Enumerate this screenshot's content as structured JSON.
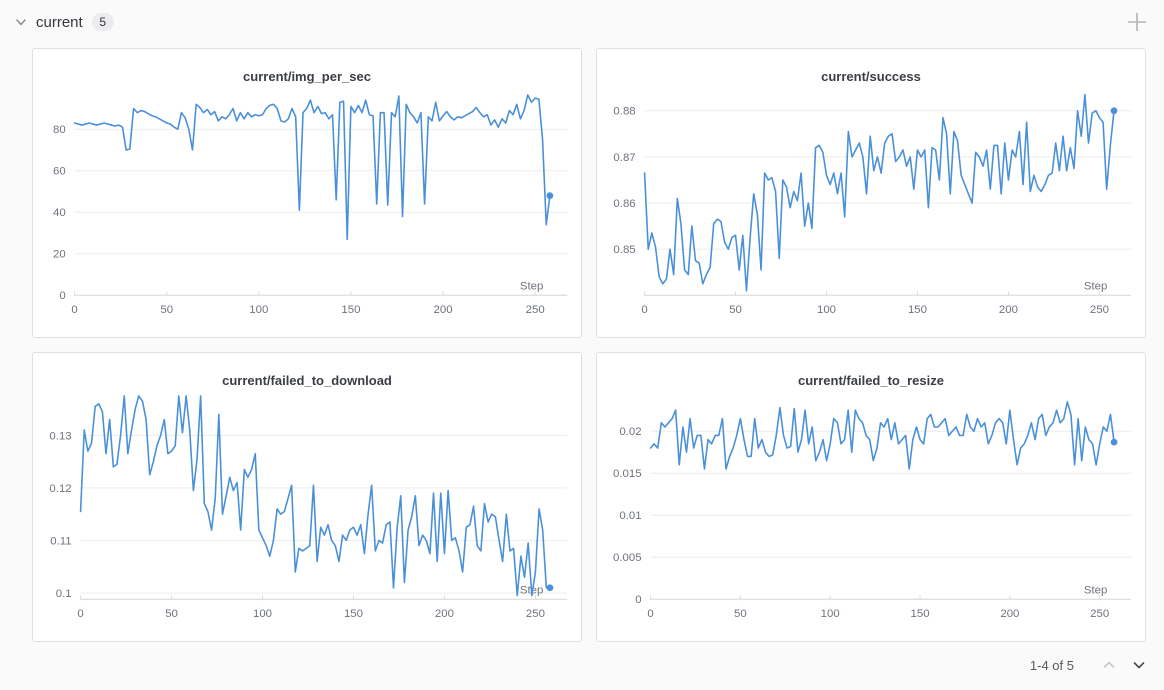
{
  "header": {
    "section_label": "current",
    "panel_count_badge": "5",
    "collapse_icon": "chevron-down-icon",
    "add_icon": "plus-icon"
  },
  "pagination": {
    "label": "1-4 of 5",
    "prev_icon": "chevron-up-icon",
    "next_icon": "chevron-down-icon",
    "prev_enabled": false,
    "next_enabled": true
  },
  "colors": {
    "series_line": "#4a90d9",
    "grid_line": "#ececec",
    "axis_line": "#d6d6d6",
    "tick_text": "#6e727c"
  },
  "chart_data": [
    {
      "type": "line",
      "title": "current/img_per_sec",
      "xlabel": "Step",
      "xticks": [
        0,
        50,
        100,
        150,
        200,
        250
      ],
      "yticks": [
        0,
        20,
        40,
        60,
        80
      ],
      "xlim": [
        0,
        262
      ],
      "ylim": [
        0,
        100
      ],
      "x_start": 0,
      "x_step": 2,
      "x_end": 258,
      "y": [
        83,
        82.5,
        82,
        82.5,
        83,
        82.5,
        82,
        82.5,
        83,
        82.5,
        82,
        81.5,
        82,
        81,
        70,
        70.5,
        90,
        88,
        89,
        88.5,
        87.5,
        86.5,
        86,
        85,
        84,
        83,
        82.5,
        81,
        80,
        88,
        85.5,
        80,
        70,
        92,
        90.5,
        88,
        89.5,
        87,
        88.5,
        84,
        86,
        85,
        87,
        90,
        84,
        88,
        85,
        88,
        86,
        87,
        86.5,
        87,
        90,
        91.5,
        92,
        90,
        84,
        83.5,
        85,
        90,
        86,
        41,
        88,
        90,
        94,
        88,
        91,
        87.5,
        88,
        85,
        87,
        46,
        93,
        93.5,
        27,
        91,
        88,
        91.5,
        88,
        94,
        87,
        86.5,
        44,
        88,
        88,
        43.5,
        88,
        86,
        96,
        38,
        92,
        88,
        86,
        83,
        88,
        44,
        86,
        84,
        93,
        84,
        86.5,
        88.5,
        86,
        84.5,
        86,
        85.5,
        86.5,
        87.5,
        88.5,
        90.5,
        88,
        86,
        87,
        82,
        84.5,
        81,
        85,
        83,
        89,
        87,
        92,
        85,
        89,
        96.5,
        93,
        95,
        94.5,
        75,
        34,
        48
      ],
      "end_marker": true
    },
    {
      "type": "line",
      "title": "current/success",
      "xlabel": "Step",
      "xticks": [
        0,
        50,
        100,
        150,
        200,
        250
      ],
      "yticks": [
        0.85,
        0.86,
        0.87,
        0.88
      ],
      "xlim": [
        0,
        262
      ],
      "ylim": [
        0.84,
        0.885
      ],
      "x_start": 0,
      "x_step": 2,
      "x_end": 258,
      "y": [
        0.8665,
        0.85,
        0.8535,
        0.8505,
        0.844,
        0.8425,
        0.8435,
        0.85,
        0.8445,
        0.861,
        0.8555,
        0.8455,
        0.8445,
        0.855,
        0.8475,
        0.847,
        0.8425,
        0.8445,
        0.846,
        0.8555,
        0.8565,
        0.856,
        0.8515,
        0.85,
        0.8525,
        0.853,
        0.8455,
        0.853,
        0.841,
        0.8525,
        0.862,
        0.8575,
        0.8455,
        0.8665,
        0.865,
        0.8655,
        0.8625,
        0.848,
        0.865,
        0.8635,
        0.859,
        0.8625,
        0.8605,
        0.8665,
        0.855,
        0.86,
        0.8545,
        0.872,
        0.8725,
        0.871,
        0.866,
        0.864,
        0.8665,
        0.862,
        0.8665,
        0.857,
        0.8755,
        0.87,
        0.8715,
        0.873,
        0.87,
        0.862,
        0.8745,
        0.867,
        0.87,
        0.8665,
        0.873,
        0.8745,
        0.875,
        0.869,
        0.87,
        0.8715,
        0.868,
        0.87,
        0.863,
        0.8715,
        0.87,
        0.8715,
        0.859,
        0.872,
        0.8715,
        0.865,
        0.8785,
        0.875,
        0.862,
        0.8755,
        0.8735,
        0.866,
        0.864,
        0.862,
        0.86,
        0.871,
        0.87,
        0.868,
        0.8715,
        0.863,
        0.8725,
        0.8725,
        0.862,
        0.873,
        0.865,
        0.8715,
        0.87,
        0.8755,
        0.864,
        0.8775,
        0.8625,
        0.866,
        0.8635,
        0.8625,
        0.864,
        0.866,
        0.8665,
        0.873,
        0.867,
        0.8745,
        0.867,
        0.872,
        0.8675,
        0.88,
        0.8745,
        0.8835,
        0.873,
        0.8795,
        0.88,
        0.8785,
        0.8775,
        0.863,
        0.8725,
        0.88
      ],
      "end_marker": true
    },
    {
      "type": "line",
      "title": "current/failed_to_download",
      "xlabel": "Step",
      "xticks": [
        0,
        50,
        100,
        150,
        200,
        250
      ],
      "yticks": [
        0.1,
        0.11,
        0.12,
        0.13
      ],
      "xlim": [
        0,
        262
      ],
      "ylim": [
        0.0988,
        0.1383
      ],
      "x_start": 0,
      "x_step": 2,
      "x_end": 258,
      "y": [
        0.1155,
        0.131,
        0.127,
        0.1285,
        0.1355,
        0.136,
        0.1345,
        0.1265,
        0.133,
        0.124,
        0.1245,
        0.13,
        0.1375,
        0.1265,
        0.131,
        0.135,
        0.1375,
        0.1365,
        0.133,
        0.1225,
        0.125,
        0.128,
        0.13,
        0.133,
        0.1265,
        0.127,
        0.128,
        0.1375,
        0.1305,
        0.1375,
        0.131,
        0.1195,
        0.1255,
        0.1375,
        0.117,
        0.1155,
        0.112,
        0.118,
        0.134,
        0.115,
        0.1185,
        0.122,
        0.1195,
        0.121,
        0.112,
        0.1235,
        0.122,
        0.1235,
        0.1265,
        0.112,
        0.1105,
        0.109,
        0.107,
        0.11,
        0.116,
        0.115,
        0.1155,
        0.118,
        0.1205,
        0.104,
        0.1085,
        0.108,
        0.1085,
        0.109,
        0.1205,
        0.106,
        0.1125,
        0.111,
        0.113,
        0.11,
        0.109,
        0.106,
        0.111,
        0.11,
        0.112,
        0.1125,
        0.111,
        0.113,
        0.1075,
        0.115,
        0.1205,
        0.108,
        0.11,
        0.1095,
        0.113,
        0.1135,
        0.101,
        0.1125,
        0.1185,
        0.102,
        0.112,
        0.1145,
        0.1185,
        0.109,
        0.111,
        0.11,
        0.1075,
        0.119,
        0.106,
        0.119,
        0.1075,
        0.1195,
        0.11,
        0.1105,
        0.108,
        0.104,
        0.1125,
        0.113,
        0.1165,
        0.109,
        0.108,
        0.117,
        0.1135,
        0.115,
        0.1145,
        0.11,
        0.106,
        0.115,
        0.108,
        0.1085,
        0.0995,
        0.107,
        0.103,
        0.1095,
        0.0995,
        0.104,
        0.116,
        0.112,
        0.101,
        0.101
      ],
      "end_marker": true
    },
    {
      "type": "line",
      "title": "current/failed_to_resize",
      "xlabel": "Step",
      "xticks": [
        0,
        50,
        100,
        150,
        200,
        250
      ],
      "yticks": [
        0,
        0.005,
        0.01,
        0.015,
        0.02
      ],
      "xlim": [
        0,
        262
      ],
      "ylim": [
        0,
        0.0247
      ],
      "x_start": 0,
      "x_step": 2,
      "x_end": 258,
      "y": [
        0.018,
        0.0185,
        0.018,
        0.021,
        0.0205,
        0.021,
        0.0215,
        0.0225,
        0.016,
        0.0205,
        0.0175,
        0.0215,
        0.018,
        0.0195,
        0.0195,
        0.0155,
        0.019,
        0.0185,
        0.0195,
        0.0195,
        0.0215,
        0.0155,
        0.017,
        0.018,
        0.0195,
        0.0215,
        0.019,
        0.017,
        0.017,
        0.0215,
        0.018,
        0.019,
        0.0175,
        0.017,
        0.0172,
        0.0195,
        0.0228,
        0.0195,
        0.018,
        0.0182,
        0.0227,
        0.0175,
        0.019,
        0.0225,
        0.0185,
        0.0205,
        0.0165,
        0.0175,
        0.019,
        0.0165,
        0.0185,
        0.0215,
        0.021,
        0.0185,
        0.019,
        0.0225,
        0.0175,
        0.0225,
        0.0215,
        0.021,
        0.0195,
        0.019,
        0.0165,
        0.018,
        0.021,
        0.0205,
        0.0215,
        0.019,
        0.021,
        0.0185,
        0.019,
        0.0195,
        0.0155,
        0.019,
        0.0205,
        0.019,
        0.0185,
        0.0215,
        0.022,
        0.0205,
        0.0205,
        0.021,
        0.0215,
        0.0195,
        0.02,
        0.0205,
        0.0195,
        0.0195,
        0.022,
        0.0205,
        0.02,
        0.0215,
        0.0205,
        0.021,
        0.0185,
        0.0195,
        0.021,
        0.0215,
        0.021,
        0.0185,
        0.0225,
        0.019,
        0.016,
        0.018,
        0.0185,
        0.0195,
        0.021,
        0.019,
        0.0215,
        0.022,
        0.0195,
        0.0205,
        0.021,
        0.0225,
        0.021,
        0.0215,
        0.0235,
        0.022,
        0.016,
        0.0215,
        0.0165,
        0.0205,
        0.019,
        0.0185,
        0.016,
        0.0185,
        0.0205,
        0.02,
        0.022,
        0.0187
      ],
      "end_marker": true
    }
  ]
}
